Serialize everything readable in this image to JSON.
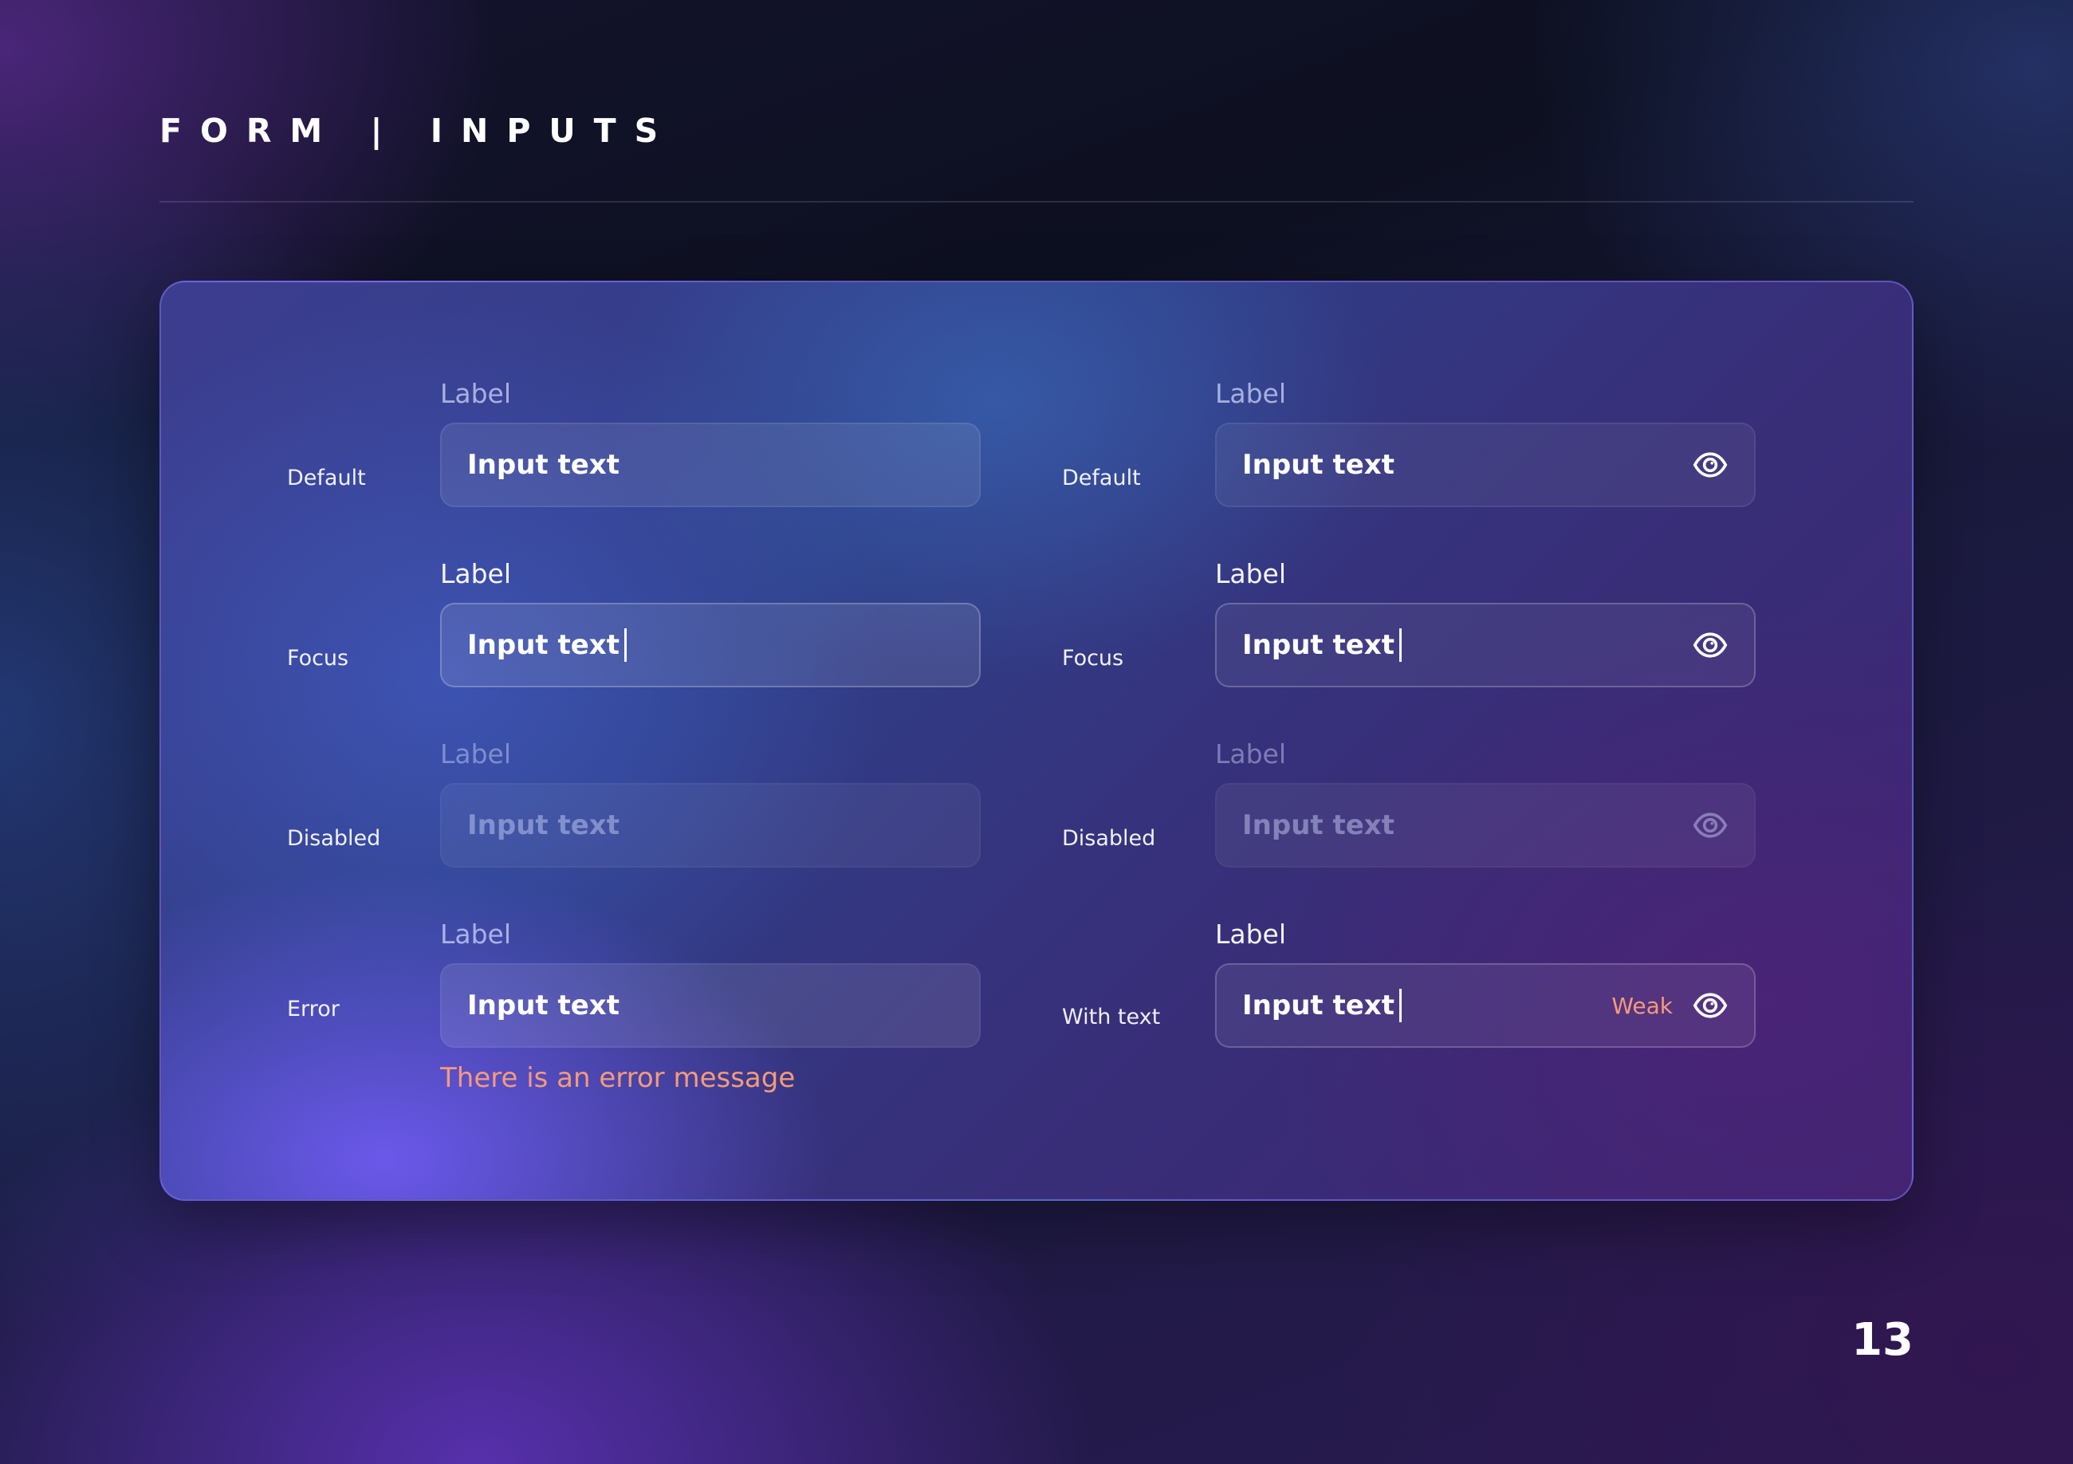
{
  "header": {
    "title": "FORM | INPUTS"
  },
  "left_column": {
    "rows": [
      {
        "state": "Default",
        "label": "Label",
        "value": "Input text"
      },
      {
        "state": "Focus",
        "label": "Label",
        "value": "Input text"
      },
      {
        "state": "Disabled",
        "label": "Label",
        "value": "Input text"
      },
      {
        "state": "Error",
        "label": "Label",
        "value": "Input text",
        "error_message": "There is an error message"
      }
    ]
  },
  "right_column": {
    "rows": [
      {
        "state": "Default",
        "label": "Label",
        "value": "Input text",
        "icon": "eye-icon"
      },
      {
        "state": "Focus",
        "label": "Label",
        "value": "Input text",
        "icon": "eye-icon"
      },
      {
        "state": "Disabled",
        "label": "Label",
        "value": "Input text",
        "icon": "eye-icon"
      },
      {
        "state": "With text",
        "label": "Label",
        "value": "Input text",
        "strength": "Weak",
        "icon": "eye-icon"
      }
    ]
  },
  "colors": {
    "error": "#f59a7a",
    "card_border": "#8278f0"
  },
  "footer": {
    "page_number": "13"
  }
}
